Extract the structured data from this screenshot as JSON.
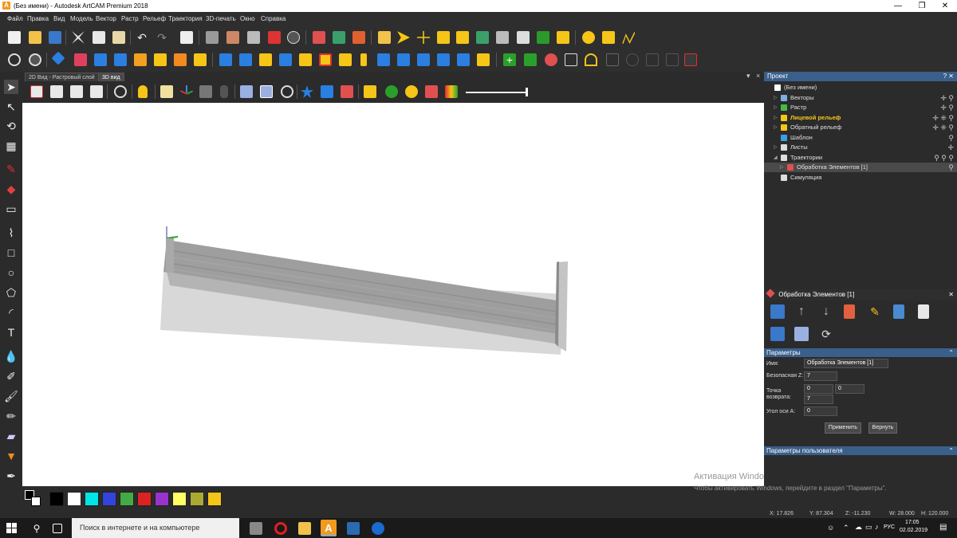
{
  "window": {
    "title": "(Без имени) - Autodesk ArtCAM Premium 2018",
    "app_icon_letter": "A",
    "controls": {
      "minimize": "—",
      "maximize": "❐",
      "close": "✕"
    }
  },
  "menu": [
    "Файл",
    "Правка",
    "Вид",
    "Модель",
    "Вектор",
    "Растр",
    "Рельеф",
    "Траектория",
    "3D-печать",
    "Окно",
    "Справка"
  ],
  "view_tabs": {
    "tab_2d": "2D Вид - Растровый слой",
    "tab_3d": "3D вид",
    "pin": "▾",
    "close": "×"
  },
  "project_panel": {
    "title": "Проект",
    "controls": "? ✕",
    "tree": [
      {
        "label": "(Без имени)",
        "icon": "document-icon",
        "color": "#ffffff",
        "indent": 0,
        "arrow": "",
        "actions": ""
      },
      {
        "label": "Векторы",
        "icon": "vectors-icon",
        "color": "#7ab0e0",
        "indent": 1,
        "arrow": "▷",
        "actions": "✛ ⚲"
      },
      {
        "label": "Растр",
        "icon": "raster-icon",
        "color": "#44bb44",
        "indent": 1,
        "arrow": "▷",
        "actions": "✛ ⚲"
      },
      {
        "label": "Лицевой рельеф",
        "icon": "star-icon",
        "color": "#f5c518",
        "indent": 1,
        "arrow": "▷",
        "actions": "✛ ⁜ ⚲",
        "bold": true
      },
      {
        "label": "Обратный рельеф",
        "icon": "star-icon",
        "color": "#f5c518",
        "indent": 1,
        "arrow": "▷",
        "actions": "✛ ⁜ ⚲"
      },
      {
        "label": "Шаблон",
        "icon": "template-star-icon",
        "color": "#3aa0e0",
        "indent": 1,
        "arrow": "",
        "actions": "⚲"
      },
      {
        "label": "Листы",
        "icon": "sheets-icon",
        "color": "#dddddd",
        "indent": 1,
        "arrow": "▷",
        "actions": "✛"
      },
      {
        "label": "Траектории",
        "icon": "toolpaths-icon",
        "color": "#dddddd",
        "indent": 1,
        "arrow": "◢",
        "actions": "⚲ ⚲ ⚲"
      },
      {
        "label": "Обработка Элементов [1]",
        "icon": "feature-machining-icon",
        "color": "#e05050",
        "indent": 2,
        "arrow": "▷",
        "actions": "⚲",
        "selected": true
      },
      {
        "label": "Симуляция",
        "icon": "simulation-icon",
        "color": "#dddddd",
        "indent": 1,
        "arrow": "",
        "actions": ""
      }
    ]
  },
  "toolpath_panel": {
    "title": "Обработка Элементов [1]",
    "close": "✕",
    "params_title": "Параметры",
    "user_params_title": "Параметры пользователя",
    "labels": {
      "name": "Имя:",
      "safe_z": "Безопасная Z:",
      "home_1": "Точка",
      "home_2": "возврата:",
      "a_axis": "Угол оси А:"
    },
    "values": {
      "name": "Обработка Элементов [1]",
      "safe_z": "7",
      "home_x": "0",
      "home_y": "0",
      "home_z": "7",
      "a_axis": "0"
    },
    "apply": "Применить",
    "revert": "Вернуть"
  },
  "status": {
    "x": "X: 17.826",
    "y": "Y: 87.304",
    "z": "Z: -11.230",
    "w": "W: 28.000",
    "h": "H: 120.000"
  },
  "activation": {
    "line1": "Активация Windows",
    "line2": "Чтобы активировать Windows, перейдите в раздел \"Параметры\"."
  },
  "taskbar": {
    "search_placeholder": "Поиск в интернете и на компьютере",
    "lang": "РУС",
    "time": "17:05",
    "date": "02.02.2019"
  },
  "palette": [
    "#000000",
    "#ffffff",
    "#00e5e5",
    "#3344dd",
    "#44aa44",
    "#dd2222",
    "#9933cc",
    "#ffff66",
    "#aaaa33",
    "#f5c518"
  ],
  "colors": {
    "panel_header": "#3a5f8a",
    "accent_orange": "#f29a1f"
  }
}
